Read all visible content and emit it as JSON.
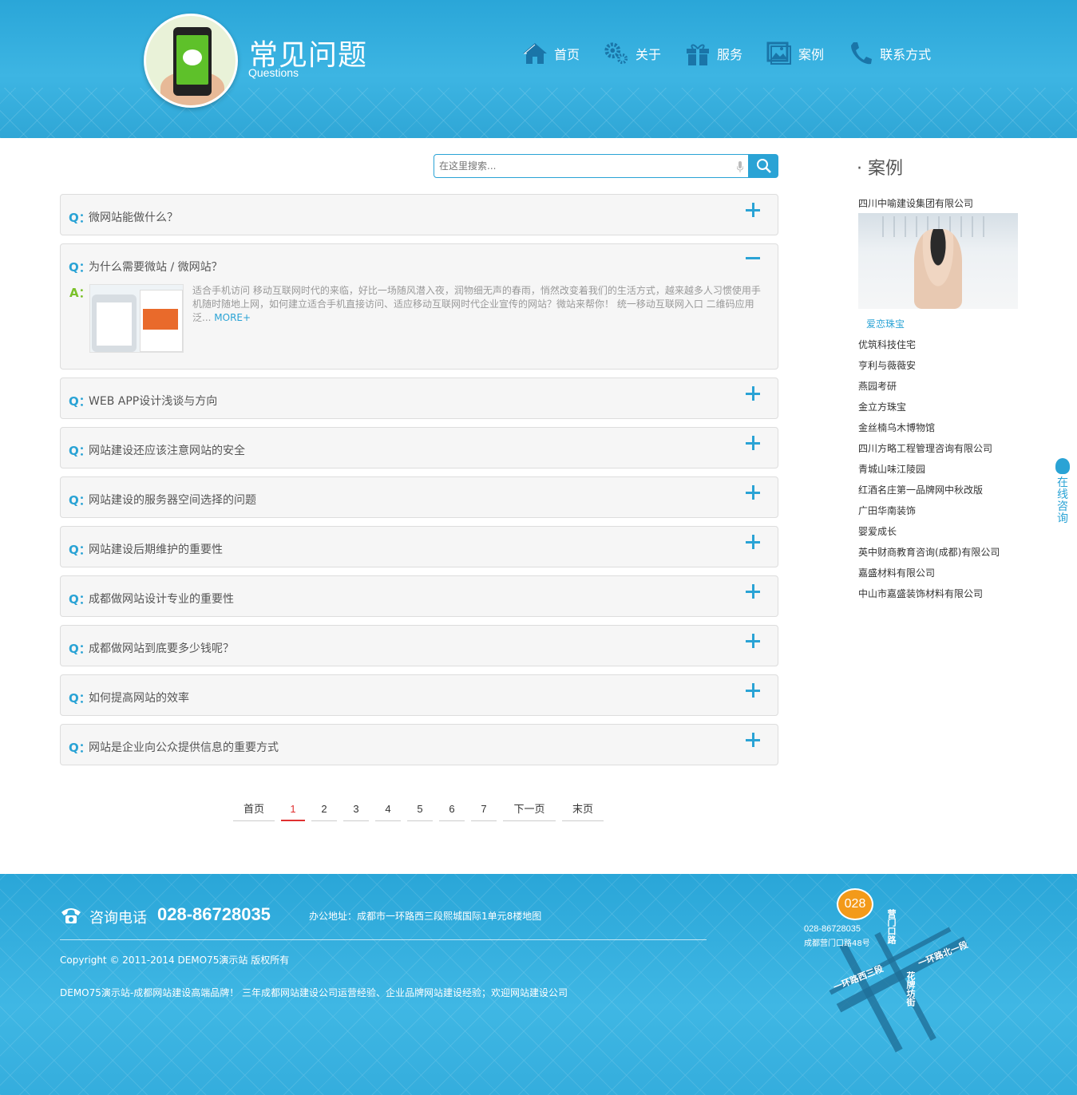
{
  "header": {
    "title": "常见问题",
    "subtitle": "Questions",
    "nav": [
      {
        "label": "首页",
        "icon": "home-icon"
      },
      {
        "label": "关于",
        "icon": "gears-icon"
      },
      {
        "label": "服务",
        "icon": "gift-icon"
      },
      {
        "label": "案例",
        "icon": "picture-icon"
      },
      {
        "label": "联系方式",
        "icon": "phone-icon"
      }
    ]
  },
  "search": {
    "placeholder": "在这里搜索..."
  },
  "faq": [
    {
      "q": "Q：",
      "text": "微网站能做什么？"
    },
    {
      "q": "Q：",
      "text": "为什么需要微站 / 微网站？",
      "answer_label": "A：",
      "answer": "适合手机访问 移动互联网时代的来临，好比一场随风潜入夜，润物细无声的春雨，悄然改变着我们的生活方式，越来越多人习惯使用手机随时随地上网，如何建立适合手机直接访问、适应移动互联网时代企业宣传的网站？微站来帮你！ 统一移动互联网入口 二维码应用泛...",
      "more": "MORE+"
    },
    {
      "q": "Q：",
      "text": "WEB APP设计浅谈与方向"
    },
    {
      "q": "Q：",
      "text": "网站建设还应该注意网站的安全"
    },
    {
      "q": "Q：",
      "text": "网站建设的服务器空间选择的问题"
    },
    {
      "q": "Q：",
      "text": "网站建设后期维护的重要性"
    },
    {
      "q": "Q：",
      "text": "成都做网站设计专业的重要性"
    },
    {
      "q": "Q：",
      "text": "成都做网站到底要多少钱呢？"
    },
    {
      "q": "Q：",
      "text": "如何提高网站的效率"
    },
    {
      "q": "Q：",
      "text": "网站是企业向公众提供信息的重要方式"
    }
  ],
  "pager": {
    "first": "首页",
    "pages": [
      "1",
      "2",
      "3",
      "4",
      "5",
      "6",
      "7"
    ],
    "current": "1",
    "next": "下一页",
    "last": "末页"
  },
  "sidebar": {
    "title": "· 案例",
    "featured": "四川中喻建设集团有限公司",
    "highlight": "爱恋珠宝",
    "items": [
      "优筑科技住宅",
      "亨利与薇薇安",
      "燕园考研",
      "金立方珠宝",
      "金丝楠乌木博物馆",
      "四川方略工程管理咨询有限公司",
      "青城山味江陵园",
      "红酒名庄第一品牌网中秋改版",
      "广田华南装饰",
      "婴爱成长",
      "英中财商教育咨询(成都)有限公司",
      "嘉盛材料有限公司",
      "中山市嘉盛装饰材料有限公司"
    ]
  },
  "float_qq": {
    "label": "在线咨询"
  },
  "footer": {
    "phone_label": "咨询电话",
    "phone": "028-86728035",
    "address": "办公地址：成都市一环路西三段熙城国际1单元8楼地图",
    "copyright": "Copyright © 2011-2014 DEMO75演示站 版权所有",
    "description": "DEMO75演示站-成都网站建设高端品牌！ 三年成都网站建设公司运营经验、企业品牌网站建设经验；欢迎网站建设公司",
    "map": {
      "badge": "028",
      "tel": "028-86728035",
      "addr": "成都营门口路48号",
      "roads": [
        "营门口路",
        "一环路北一段",
        "一环路西三段",
        "花牌坊街"
      ]
    }
  },
  "colors": {
    "accent": "#2aa3d5",
    "answer": "#7bc12a",
    "current_page": "#e03030"
  }
}
